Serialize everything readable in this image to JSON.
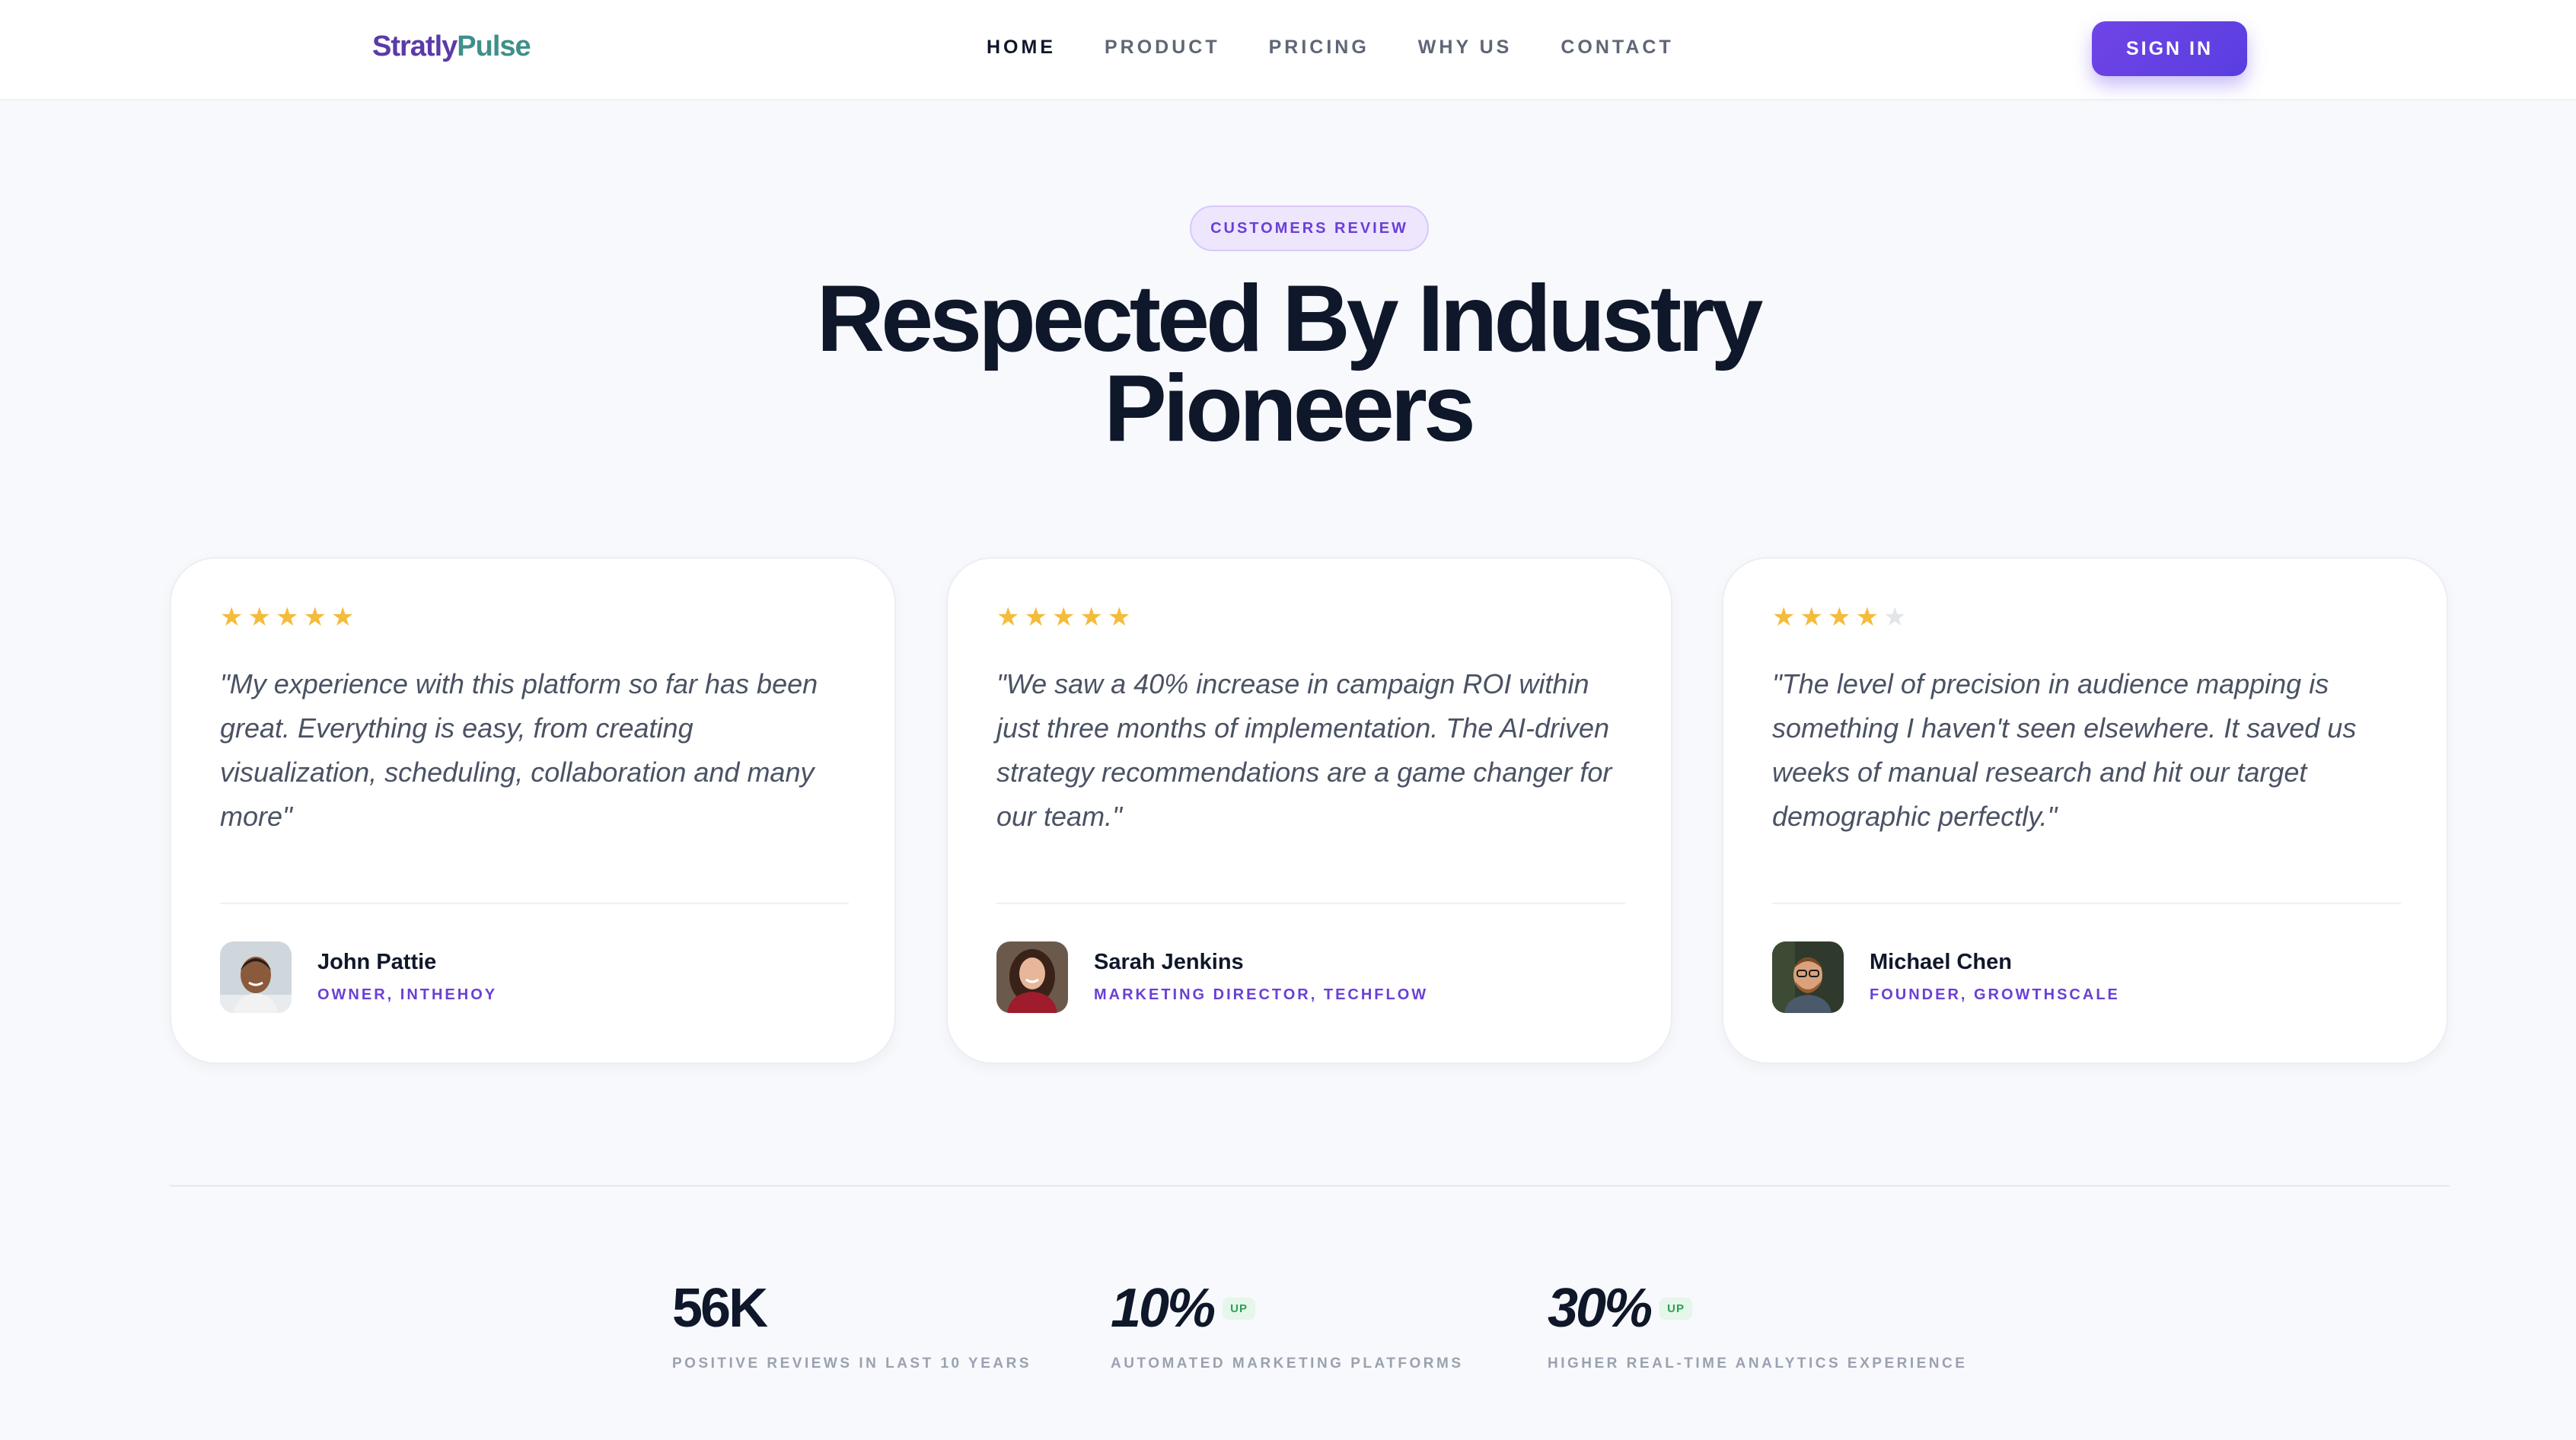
{
  "header": {
    "logo_part1": "Stratly",
    "logo_part2": "Pulse",
    "nav": [
      {
        "label": "HOME",
        "active": true
      },
      {
        "label": "PRODUCT",
        "active": false
      },
      {
        "label": "PRICING",
        "active": false
      },
      {
        "label": "WHY US",
        "active": false
      },
      {
        "label": "CONTACT",
        "active": false
      }
    ],
    "signin_label": "SIGN IN"
  },
  "hero": {
    "badge": "CUSTOMERS REVIEW",
    "title_line1": "Respected By Industry",
    "title_line2": "Pioneers"
  },
  "testimonials": [
    {
      "rating": 5,
      "quote": "\"My experience with this platform so far has been great. Everything is easy, from creating visualization, scheduling, collaboration and many more\"",
      "name": "John Pattie",
      "role": "OWNER, INTHEHOY"
    },
    {
      "rating": 5,
      "quote": "\"We saw a 40% increase in campaign ROI within just three months of implementation. The AI-driven strategy recommendations are a game changer for our team.\"",
      "name": "Sarah Jenkins",
      "role": "MARKETING DIRECTOR, TECHFLOW"
    },
    {
      "rating": 4,
      "quote": "\"The level of precision in audience mapping is something I haven't seen elsewhere. It saved us weeks of manual research and hit our target demographic perfectly.\"",
      "name": "Michael Chen",
      "role": "FOUNDER, GROWTHSCALE"
    }
  ],
  "stats": [
    {
      "value": "56K",
      "badge": "",
      "label": "POSITIVE REVIEWS IN LAST 10 YEARS"
    },
    {
      "value": "10%",
      "badge": "UP",
      "label": "AUTOMATED MARKETING PLATFORMS"
    },
    {
      "value": "30%",
      "badge": "UP",
      "label": "HIGHER REAL-TIME ANALYTICS EXPERIENCE"
    }
  ],
  "colors": {
    "accent": "#6a3fd6",
    "star": "#f5bb3a",
    "up_green": "#2f9e55"
  }
}
